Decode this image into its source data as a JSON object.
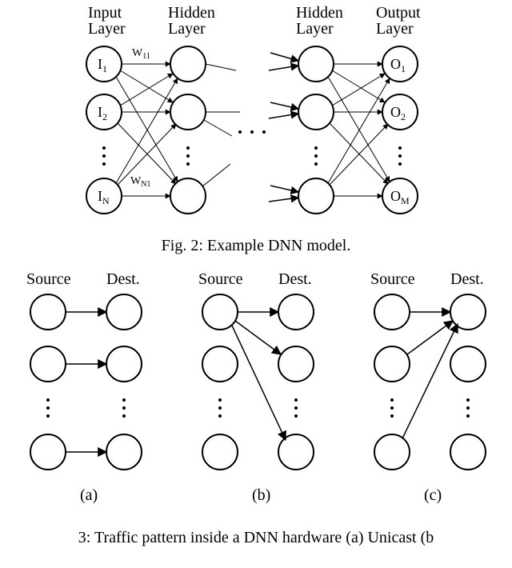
{
  "fig2": {
    "labels": {
      "input": "Input\nLayer",
      "hidden1": "Hidden\nLayer",
      "hidden2": "Hidden\nLayer",
      "output": "Output\nLayer",
      "w11": "W",
      "w11_sub": "11",
      "wN1": "W",
      "wN1_sub": "N1",
      "i": "I",
      "o": "O",
      "sub1": "1",
      "sub2": "2",
      "subN": "N",
      "subM": "M"
    },
    "caption": "Fig. 2: Example DNN model."
  },
  "fig3": {
    "labels": {
      "source": "Source",
      "dest": "Dest.",
      "a": "(a)",
      "b": "(b)",
      "c": "(c)"
    },
    "caption": "3: Traffic pattern inside a DNN hardware (a) Unicast (b"
  }
}
